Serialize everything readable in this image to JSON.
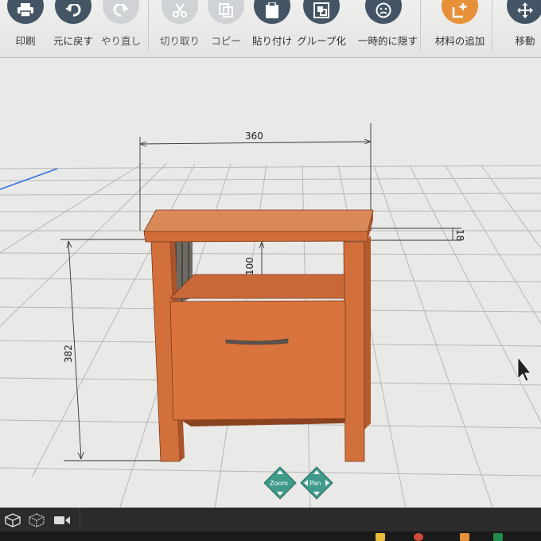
{
  "toolbar": {
    "items": [
      {
        "label": "印刷",
        "icon": "print-icon",
        "enabled": true
      },
      {
        "label": "元に戻す",
        "icon": "undo-icon",
        "enabled": true
      },
      {
        "label": "やり直し",
        "icon": "redo-icon",
        "enabled": false
      },
      {
        "label": "切り取り",
        "icon": "scissors-icon",
        "enabled": false
      },
      {
        "label": "コピー",
        "icon": "copy-icon",
        "enabled": false
      },
      {
        "label": "貼り付け",
        "icon": "paste-icon",
        "enabled": true
      },
      {
        "label": "グループ化",
        "icon": "group-icon",
        "enabled": true
      },
      {
        "label": "一時的に隠す",
        "icon": "hide-face-icon",
        "enabled": true
      },
      {
        "label": "材料の追加",
        "icon": "add-material-icon",
        "enabled": true,
        "accent": "#e6913a"
      },
      {
        "label": "移動",
        "icon": "move-arrows-icon",
        "enabled": true
      }
    ]
  },
  "dimensions": {
    "width": "360",
    "height": "382",
    "shelf_gap": "100",
    "top_thickness": "18"
  },
  "navigation": {
    "zoom_label": "Zoom",
    "pan_label": "Pan"
  },
  "colors": {
    "toolbar_icon": "#435564",
    "toolbar_icon_disabled": "#cfd3d6",
    "accent": "#e6913a",
    "wood": "#d9743e",
    "grid_bg": "#e9e9e7"
  }
}
